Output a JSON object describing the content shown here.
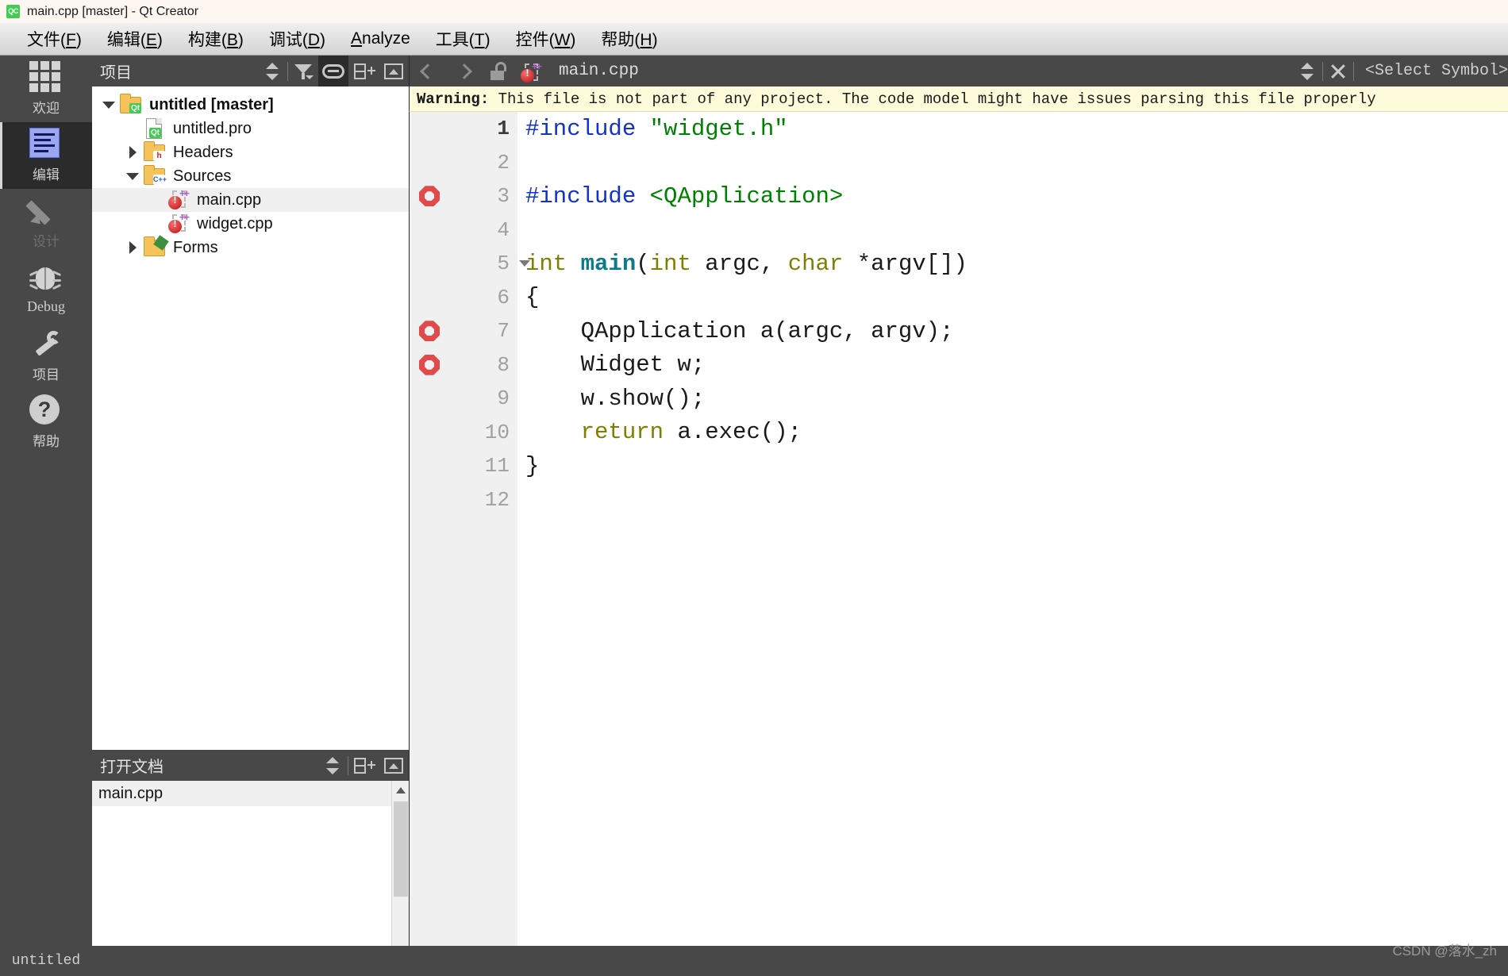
{
  "window": {
    "title": "main.cpp [master] - Qt Creator",
    "logo_text": "QC"
  },
  "menubar": {
    "items": [
      {
        "label": "文件",
        "accel": "F"
      },
      {
        "label": "编辑",
        "accel": "E"
      },
      {
        "label": "构建",
        "accel": "B"
      },
      {
        "label": "调试",
        "accel": "D"
      },
      {
        "label": "Analyze",
        "accel": "A",
        "inline": true
      },
      {
        "label": "工具",
        "accel": "T"
      },
      {
        "label": "控件",
        "accel": "W"
      },
      {
        "label": "帮助",
        "accel": "H"
      }
    ]
  },
  "modebar": {
    "items": [
      {
        "label": "欢迎",
        "icon": "grid-icon",
        "state": "normal"
      },
      {
        "label": "编辑",
        "icon": "document-icon",
        "state": "active"
      },
      {
        "label": "设计",
        "icon": "pencil-icon",
        "state": "disabled"
      },
      {
        "label": "Debug",
        "icon": "bug-icon",
        "state": "normal"
      },
      {
        "label": "项目",
        "icon": "wrench-icon",
        "state": "normal"
      },
      {
        "label": "帮助",
        "icon": "question-icon",
        "state": "normal"
      }
    ]
  },
  "project_pane": {
    "title": "项目",
    "toolbar_icons": [
      "updown-selector-icon",
      "filter-icon",
      "link-icon",
      "split-icon",
      "collapse-icon"
    ],
    "tree": [
      {
        "label": "untitled [master]",
        "indent": 0,
        "twisty": "down",
        "icon": "folder-qt-icon",
        "bold": true,
        "selected": false
      },
      {
        "label": "untitled.pro",
        "indent": 1,
        "twisty": "none",
        "icon": "file-qt-icon",
        "bold": false,
        "selected": false
      },
      {
        "label": "Headers",
        "indent": 1,
        "twisty": "right",
        "icon": "folder-h-icon",
        "bold": false,
        "selected": false
      },
      {
        "label": "Sources",
        "indent": 1,
        "twisty": "down",
        "icon": "folder-cpp-icon",
        "bold": false,
        "selected": false
      },
      {
        "label": "main.cpp",
        "indent": 2,
        "twisty": "none",
        "icon": "cpp-file-icon",
        "bold": false,
        "selected": true
      },
      {
        "label": "widget.cpp",
        "indent": 2,
        "twisty": "none",
        "icon": "cpp-file-icon",
        "bold": false,
        "selected": false
      },
      {
        "label": "Forms",
        "indent": 1,
        "twisty": "right",
        "icon": "folder-form-icon",
        "bold": false,
        "selected": false
      }
    ]
  },
  "open_documents": {
    "title": "打开文档",
    "items": [
      {
        "label": "main.cpp",
        "selected": true
      }
    ]
  },
  "editor": {
    "filename": "main.cpp",
    "symbol_selector": "<Select Symbol>",
    "warning": {
      "prefix": "Warning:",
      "text": " This file is not part of any project. The code model might have issues parsing this file properly"
    },
    "lines": [
      {
        "num": "1",
        "breakpoint": false,
        "fold": false,
        "current": true,
        "tokens": [
          {
            "t": "#include ",
            "c": "k-pre"
          },
          {
            "t": "\"widget.h\"",
            "c": "k-str"
          }
        ]
      },
      {
        "num": "2",
        "breakpoint": false,
        "fold": false,
        "current": false,
        "tokens": []
      },
      {
        "num": "3",
        "breakpoint": true,
        "fold": false,
        "current": false,
        "tokens": [
          {
            "t": "#include ",
            "c": "k-pre"
          },
          {
            "t": "<QApplication>",
            "c": "k-str"
          }
        ]
      },
      {
        "num": "4",
        "breakpoint": false,
        "fold": false,
        "current": false,
        "tokens": []
      },
      {
        "num": "5",
        "breakpoint": false,
        "fold": true,
        "current": false,
        "tokens": [
          {
            "t": "int ",
            "c": "k-type"
          },
          {
            "t": "main",
            "c": "k-func"
          },
          {
            "t": "(",
            "c": "k-plain"
          },
          {
            "t": "int",
            "c": "k-type"
          },
          {
            "t": " argc, ",
            "c": "k-plain"
          },
          {
            "t": "char",
            "c": "k-type"
          },
          {
            "t": " *argv[])",
            "c": "k-plain"
          }
        ]
      },
      {
        "num": "6",
        "breakpoint": false,
        "fold": false,
        "current": false,
        "tokens": [
          {
            "t": "{",
            "c": "k-plain"
          }
        ]
      },
      {
        "num": "7",
        "breakpoint": true,
        "fold": false,
        "current": false,
        "tokens": [
          {
            "t": "    QApplication a(argc, argv);",
            "c": "k-plain"
          }
        ]
      },
      {
        "num": "8",
        "breakpoint": true,
        "fold": false,
        "current": false,
        "tokens": [
          {
            "t": "    Widget w;",
            "c": "k-plain"
          }
        ]
      },
      {
        "num": "9",
        "breakpoint": false,
        "fold": false,
        "current": false,
        "tokens": [
          {
            "t": "    w.show();",
            "c": "k-plain"
          }
        ]
      },
      {
        "num": "10",
        "breakpoint": false,
        "fold": false,
        "current": false,
        "tokens": [
          {
            "t": "    ",
            "c": "k-plain"
          },
          {
            "t": "return",
            "c": "k-kw"
          },
          {
            "t": " a.exec();",
            "c": "k-plain"
          }
        ]
      },
      {
        "num": "11",
        "breakpoint": false,
        "fold": false,
        "current": false,
        "tokens": [
          {
            "t": "}",
            "c": "k-plain"
          }
        ]
      },
      {
        "num": "12",
        "breakpoint": false,
        "fold": false,
        "current": false,
        "tokens": []
      }
    ]
  },
  "statusbar": {
    "project": "untitled"
  },
  "watermark": {
    "text": "CSDN @落水_zh"
  },
  "colors": {
    "accent_qt_green": "#41cd52",
    "breakpoint_red": "#e04a4a",
    "warning_bg": "#fdfbd9",
    "chrome_dark": "#484848",
    "mode_active": "#2b2b2b"
  }
}
